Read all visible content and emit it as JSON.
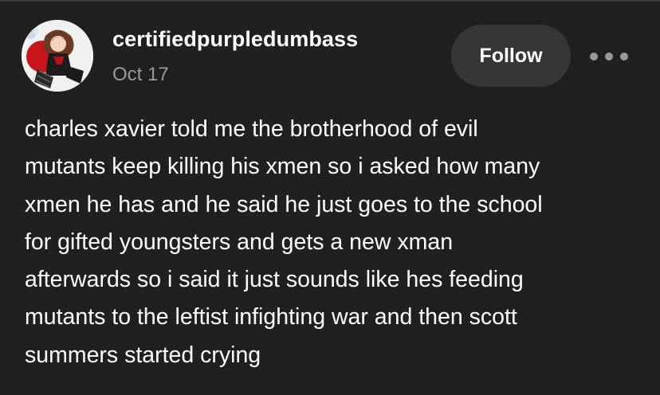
{
  "post": {
    "author": {
      "username": "certifiedpurpledumbass",
      "avatar_icon": "avatar-character-art"
    },
    "date": "Oct 17",
    "follow_label": "Follow",
    "more_icon": "more-options-icon",
    "body_lines": [
      "charles xavier told me the brotherhood of evil",
      "mutants keep killing his xmen so i asked how many",
      "xmen he has and he said he just goes to the school",
      "for gifted youngsters and gets a new xman",
      "afterwards so i said it just sounds like hes feeding",
      "mutants to the leftist infighting war and then scott",
      "summers started crying"
    ]
  },
  "colors": {
    "background": "#202020",
    "button_bg": "#363636",
    "text_primary": "#ffffff",
    "text_secondary": "#9a9a9a"
  }
}
